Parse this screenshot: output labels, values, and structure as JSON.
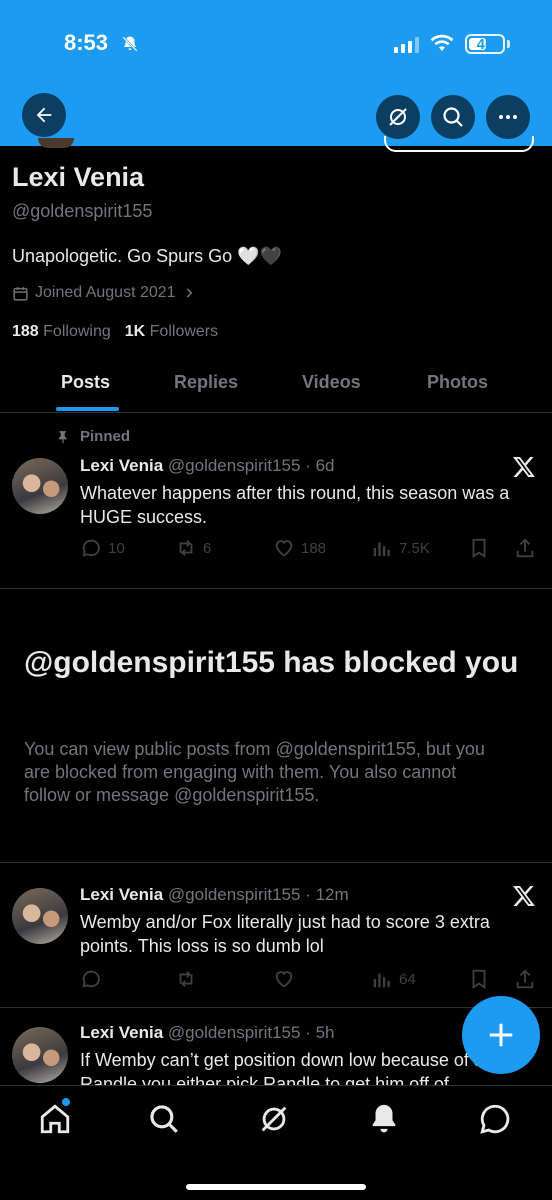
{
  "status_bar": {
    "time": "8:53",
    "battery": "46",
    "battery_level": 0.46
  },
  "header": {
    "back_icon": "arrow-left-icon",
    "grok_icon": "grok-icon",
    "search_icon": "search-icon",
    "more_icon": "more-dots-icon"
  },
  "profile": {
    "name": "Lexi Venia",
    "handle": "@goldenspirit155",
    "bio": "Unapologetic. Go Spurs Go 🤍🖤",
    "joined": "Joined August 2021",
    "following_count": "188",
    "following_label": "Following",
    "followers_count": "1K",
    "followers_label": "Followers"
  },
  "tabs": [
    {
      "label": "Posts",
      "active": true
    },
    {
      "label": "Replies",
      "active": false
    },
    {
      "label": "Videos",
      "active": false
    },
    {
      "label": "Photos",
      "active": false
    }
  ],
  "pinned_label": "Pinned",
  "posts": [
    {
      "name": "Lexi Venia",
      "meta": "@goldenspirit155 · 6d",
      "text": "Whatever happens after this round, this season was a HUGE success.",
      "replies": "10",
      "reposts": "6",
      "likes": "188",
      "views": "7.5K"
    },
    {
      "name": "Lexi Venia",
      "meta": "@goldenspirit155 · 12m",
      "text": "Wemby and/or Fox literally just had to score 3 extra points. This loss is so dumb lol",
      "replies": "",
      "reposts": "",
      "likes": "",
      "views": "64"
    },
    {
      "name": "Lexi Venia",
      "meta": "@goldenspirit155 · 5h",
      "text": "If Wemby can’t get position down low because of Julius Randle you either pick Randle to get him off of",
      "replies": "",
      "reposts": "",
      "likes": "",
      "views": ""
    }
  ],
  "blocked": {
    "title": "@goldenspirit155 has blocked you",
    "body": "You can view public posts from @goldenspirit155, but you are blocked from engaging with them. You also cannot follow or message @goldenspirit155."
  },
  "colors": {
    "accent": "#1d9bf0",
    "background": "#000000",
    "muted": "#71767b"
  }
}
